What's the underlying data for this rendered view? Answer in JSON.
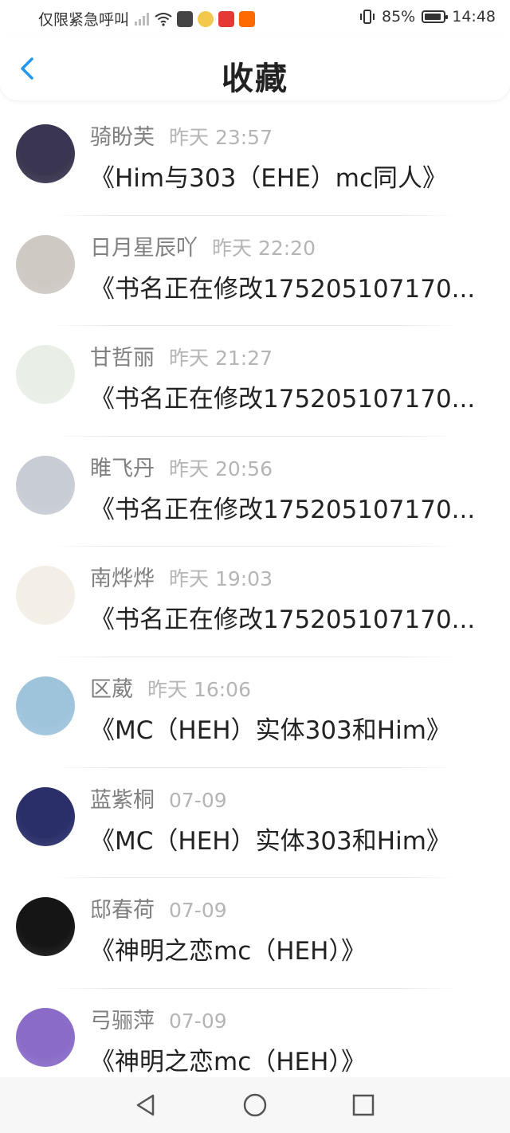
{
  "status_bar": {
    "carrier": "仅限紧急呼叫",
    "battery": "85%",
    "time": "14:48"
  },
  "header": {
    "title": "收藏",
    "back_icon": "chevron-left-icon"
  },
  "items": [
    {
      "user": "骑盼芙",
      "time": "昨天 23:57",
      "title": "《Him与303（EHE）mc同人》"
    },
    {
      "user": "日月星辰吖",
      "time": "昨天 22:20",
      "title": "《书名正在修改175205107170..."
    },
    {
      "user": "甘哲丽",
      "time": "昨天 21:27",
      "title": "《书名正在修改175205107170..."
    },
    {
      "user": "睢飞丹",
      "time": "昨天 20:56",
      "title": "《书名正在修改175205107170..."
    },
    {
      "user": "南烨烨",
      "time": "昨天 19:03",
      "title": "《书名正在修改175205107170..."
    },
    {
      "user": "区葳",
      "time": "昨天 16:06",
      "title": "《MC（HEH）实体303和Him》"
    },
    {
      "user": "蓝紫桐",
      "time": "07-09",
      "title": "《MC（HEH）实体303和Him》"
    },
    {
      "user": "邸春荷",
      "time": "07-09",
      "title": "《神明之恋mc（HEH）》"
    },
    {
      "user": "弓骊萍",
      "time": "07-09",
      "title": "《神明之恋mc（HEH）》"
    }
  ],
  "avatar_colors": [
    "#3a3550",
    "#cfc9c4",
    "#e9efe6",
    "#c8ccd4",
    "#f3efe6",
    "#9ec4dc",
    "#2a2f6a",
    "#151515",
    "#8a6cc8"
  ],
  "colors": {
    "accent": "#2196F3",
    "username": "#808080",
    "time": "#b5b5b5",
    "title": "#222222"
  },
  "nav_bar": {
    "back": "triangle-back-icon",
    "home": "circle-home-icon",
    "recents": "square-recents-icon"
  }
}
